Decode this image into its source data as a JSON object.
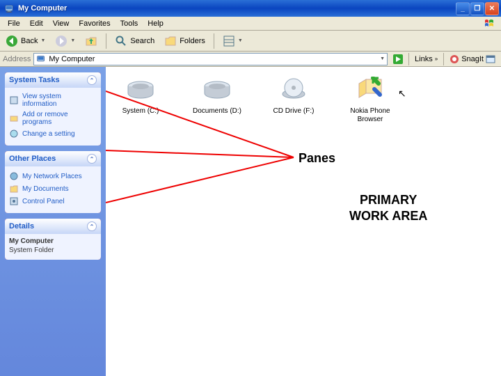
{
  "titlebar": {
    "title": "My Computer"
  },
  "menu": {
    "items": [
      "File",
      "Edit",
      "View",
      "Favorites",
      "Tools",
      "Help"
    ]
  },
  "toolbar": {
    "back": "Back",
    "search": "Search",
    "folders": "Folders"
  },
  "addressbar": {
    "label": "Address",
    "value": "My Computer",
    "links": "Links",
    "snagit": "SnagIt"
  },
  "sidepane": {
    "system_tasks": {
      "title": "System Tasks",
      "items": [
        "View system information",
        "Add or remove programs",
        "Change a setting"
      ]
    },
    "other_places": {
      "title": "Other Places",
      "items": [
        "My Network Places",
        "My Documents",
        "Control Panel"
      ]
    },
    "details": {
      "title": "Details",
      "name": "My Computer",
      "type": "System Folder"
    }
  },
  "drives": [
    {
      "label": "System (C:)"
    },
    {
      "label": "Documents (D:)"
    },
    {
      "label": "CD Drive (F:)"
    },
    {
      "label": "Nokia Phone Browser"
    }
  ],
  "annotations": {
    "panes": "Panes",
    "primary_l1": "PRIMARY",
    "primary_l2": "WORK AREA"
  }
}
